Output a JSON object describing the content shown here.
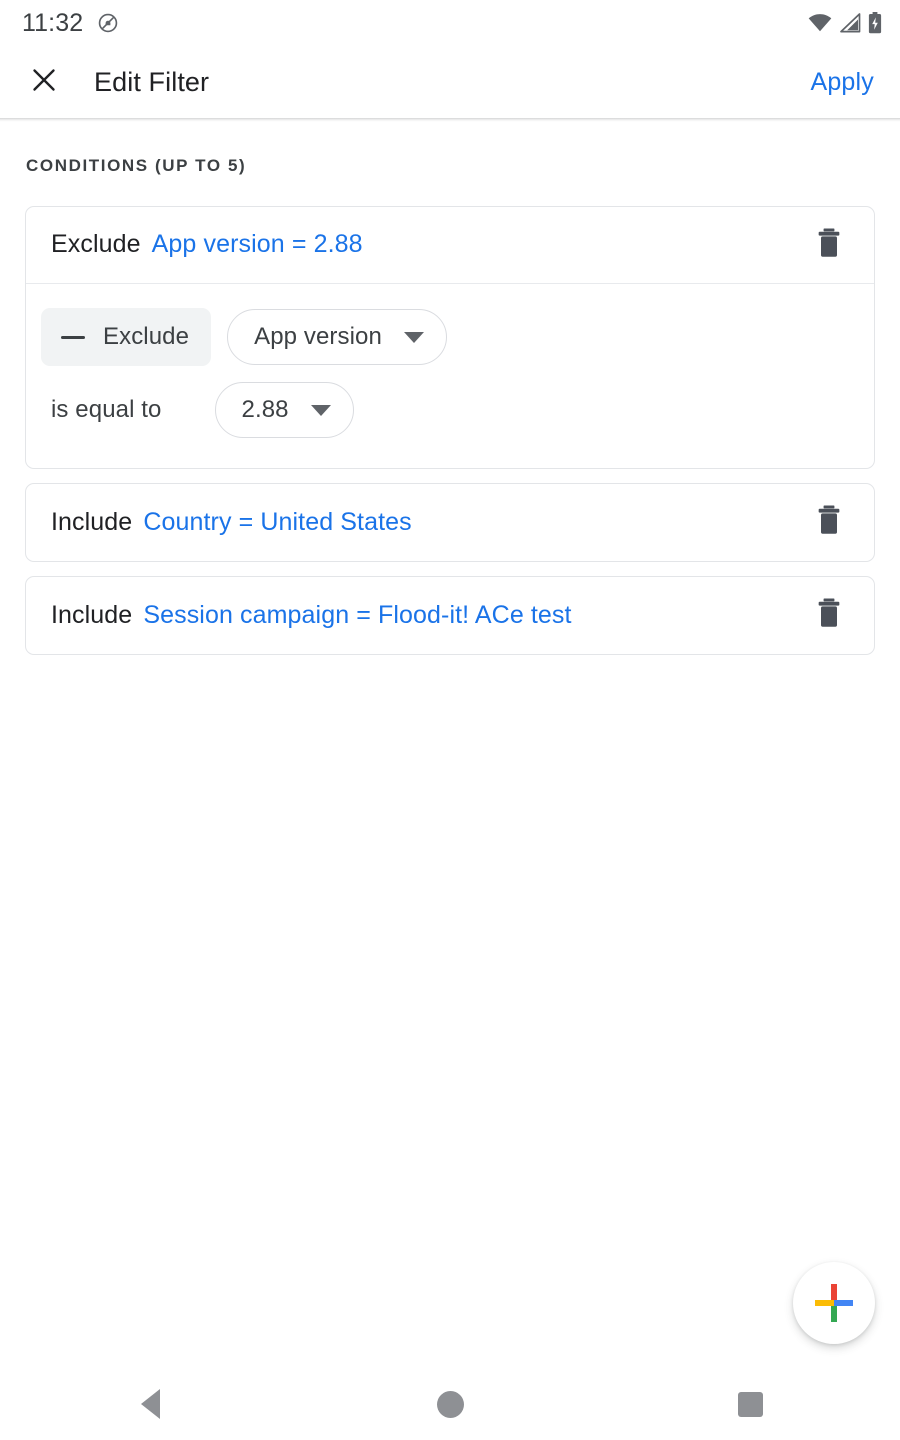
{
  "status_bar": {
    "time": "11:32",
    "left_icons": [
      "do-not-disturb-icon"
    ],
    "right_icons": [
      "wifi-icon",
      "cellular-signal-icon",
      "battery-charging-icon"
    ]
  },
  "app_bar": {
    "close_label": "close-icon",
    "title": "Edit Filter",
    "apply_label": "Apply",
    "accent_color": "#1a73e8"
  },
  "section": {
    "header": "CONDITIONS (UP TO 5)"
  },
  "conditions": [
    {
      "operator": "Exclude",
      "dimension": "App version",
      "equals": "=",
      "value": "2.88",
      "expanded": true,
      "editor": {
        "operator_chip": "Exclude",
        "dimension_chip": "App version",
        "match_label": "is equal to",
        "value_chip": "2.88"
      }
    },
    {
      "operator": "Include",
      "dimension": "Country",
      "equals": "=",
      "value": "United States",
      "expanded": false
    },
    {
      "operator": "Include",
      "dimension": "Session campaign",
      "equals": "=",
      "value": "Flood-it! ACe test",
      "expanded": false
    }
  ],
  "fab": {
    "label": "add-condition",
    "colors": {
      "red": "#ea4335",
      "green": "#34a853",
      "yellow": "#fbbc05",
      "blue": "#4285f4"
    }
  },
  "nav_bar": {
    "back": "back-icon",
    "home": "home-icon",
    "recents": "recents-icon"
  }
}
